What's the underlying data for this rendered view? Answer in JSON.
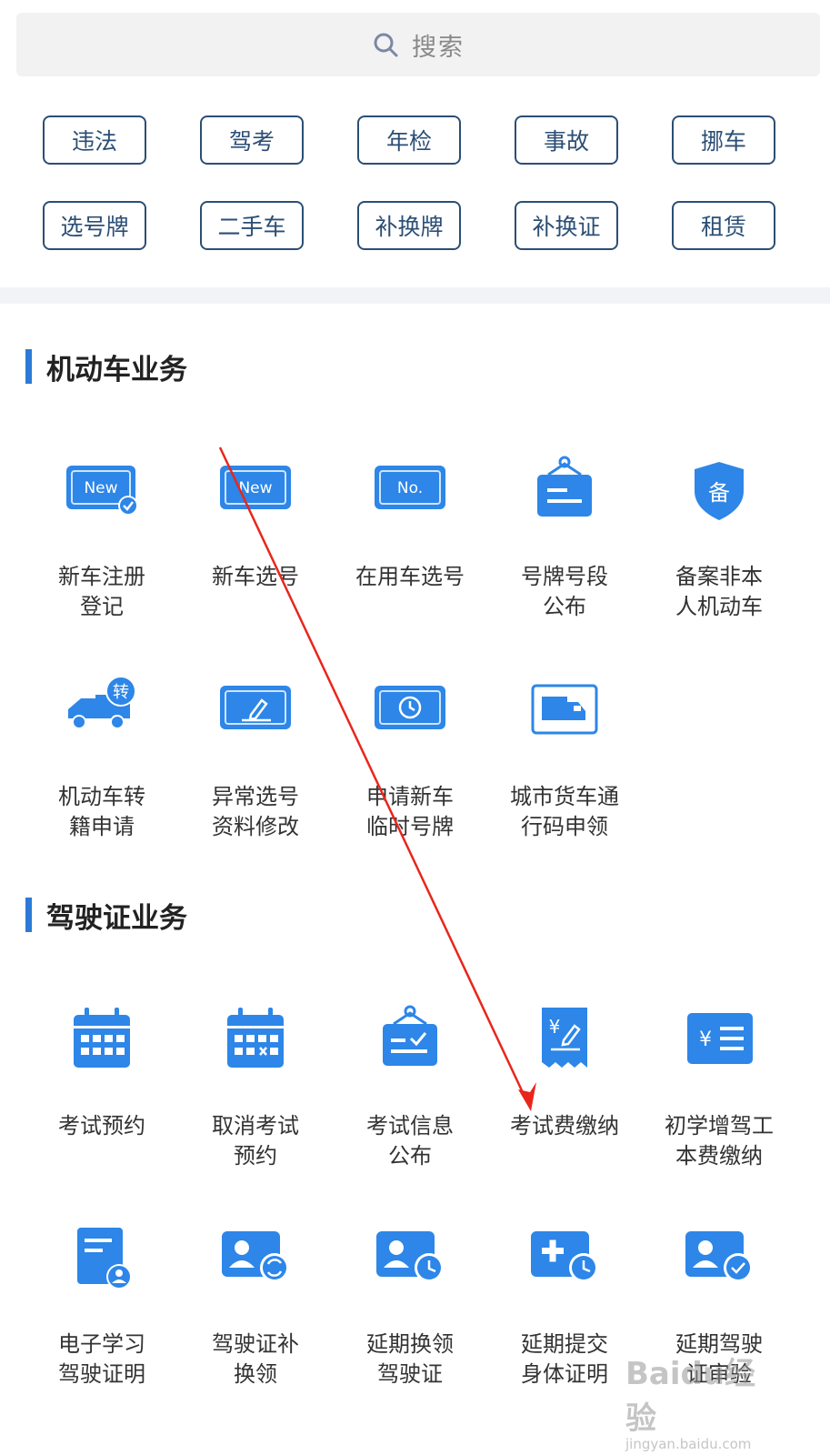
{
  "search": {
    "placeholder": "搜索",
    "icon": "search-icon"
  },
  "chips": [
    {
      "label": "违法"
    },
    {
      "label": "驾考"
    },
    {
      "label": "年检"
    },
    {
      "label": "事故"
    },
    {
      "label": "挪车"
    },
    {
      "label": "选号牌"
    },
    {
      "label": "二手车"
    },
    {
      "label": "补换牌"
    },
    {
      "label": "补换证"
    },
    {
      "label": "租赁"
    }
  ],
  "sections": [
    {
      "title": "机动车业务",
      "items": [
        {
          "label": "新车注册\n登记",
          "icon": "new-plate-check-icon"
        },
        {
          "label": "新车选号",
          "icon": "new-plate-icon"
        },
        {
          "label": "在用车选号",
          "icon": "no-plate-icon"
        },
        {
          "label": "号牌号段\n公布",
          "icon": "hanging-sign-icon"
        },
        {
          "label": "备案非本\n人机动车",
          "icon": "shield-bei-icon"
        },
        {
          "label": "机动车转\n籍申请",
          "icon": "truck-transfer-icon"
        },
        {
          "label": "异常选号\n资料修改",
          "icon": "plate-edit-icon"
        },
        {
          "label": "申请新车\n临时号牌",
          "icon": "plate-clock-icon"
        },
        {
          "label": "城市货车通\n行码申领",
          "icon": "truck-pass-icon"
        }
      ]
    },
    {
      "title": "驾驶证业务",
      "items": [
        {
          "label": "考试预约",
          "icon": "calendar-icon"
        },
        {
          "label": "取消考试\n预约",
          "icon": "calendar-cancel-icon"
        },
        {
          "label": "考试信息\n公布",
          "icon": "hanging-sign-check-icon"
        },
        {
          "label": "考试费缴纳",
          "icon": "receipt-yen-icon"
        },
        {
          "label": "初学增驾工\n本费缴纳",
          "icon": "yen-list-icon"
        },
        {
          "label": "电子学习\n驾驶证明",
          "icon": "document-person-icon"
        },
        {
          "label": "驾驶证补\n换领",
          "icon": "id-card-refresh-icon"
        },
        {
          "label": "延期换领\n驾驶证",
          "icon": "id-card-clock-icon"
        },
        {
          "label": "延期提交\n身体证明",
          "icon": "medical-clock-icon"
        },
        {
          "label": "延期驾驶\n证审验",
          "icon": "id-card-check-icon"
        }
      ]
    }
  ],
  "watermark": {
    "text": "Baidu经验",
    "url": "jingyan.baidu.com"
  },
  "colors": {
    "accent": "#2d7ad6",
    "chip_border": "#2b4e75",
    "annotation_arrow": "#e8261c"
  }
}
